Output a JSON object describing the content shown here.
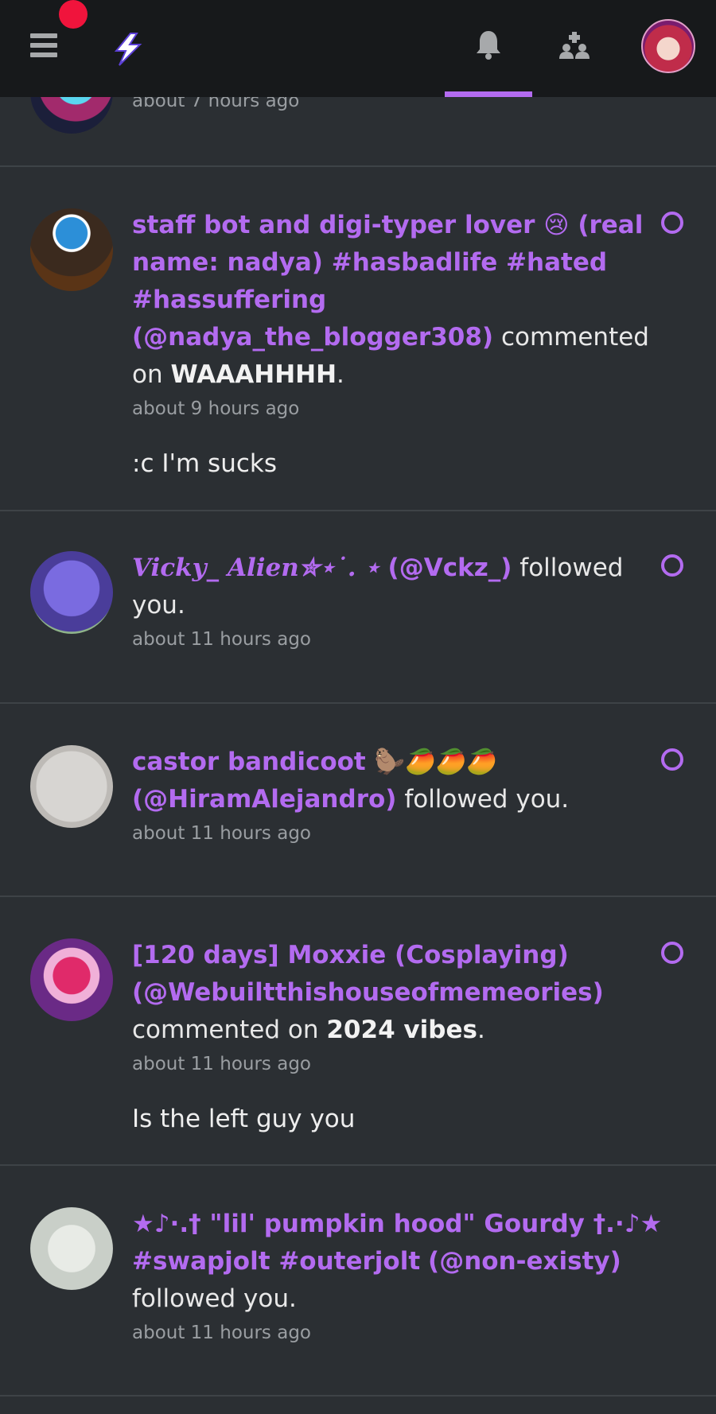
{
  "top_partial": {
    "time": "about 7 hours ago"
  },
  "notifications": [
    {
      "name": "staff bot and digi-typer lover 😢 (real name: nadya) #hasbadlife #hated #hassuffering",
      "handle": "(@nadya_the_blogger308)",
      "action": "commented on",
      "target": "WAAAHHHH",
      "tail": ".",
      "time": "about 9 hours ago",
      "comment": ":c I'm sucks",
      "unread": true
    },
    {
      "name": "Vicky_ Alien✮⋆˙. ⋆",
      "handle": "(@Vckz_)",
      "action": "followed you.",
      "time": "about 11 hours ago",
      "unread": true
    },
    {
      "name": "castor bandicoot 🦫🥭🥭🥭",
      "handle": "(@HiramAlejandro)",
      "action": "followed you.",
      "time": "about 11 hours ago",
      "unread": true
    },
    {
      "name": "[120 days] Moxxie (Cosplaying)",
      "handle": "(@Webuiltthishouseofmemeories)",
      "action": "commented on",
      "target": "2024 vibes",
      "tail": ".",
      "time": "about 11 hours ago",
      "comment": "Is the left guy you",
      "unread": true
    },
    {
      "name": "★♪⋅.† \"lil' pumpkin hood\" Gourdy †.⋅♪★ #swapjolt #outerjolt",
      "handle": "(@non-existy)",
      "action": "followed you.",
      "time": "about 11 hours ago",
      "unread": false
    }
  ],
  "icons": {
    "menu": "hamburger-icon",
    "logo": "lightning-logo-icon",
    "notifications": "bell-icon",
    "groups": "groups-icon",
    "profile": "avatar"
  },
  "colors": {
    "accent": "#b36bf0",
    "background": "#2b2f33",
    "topbar": "#17191b",
    "badge": "#f0143c"
  }
}
